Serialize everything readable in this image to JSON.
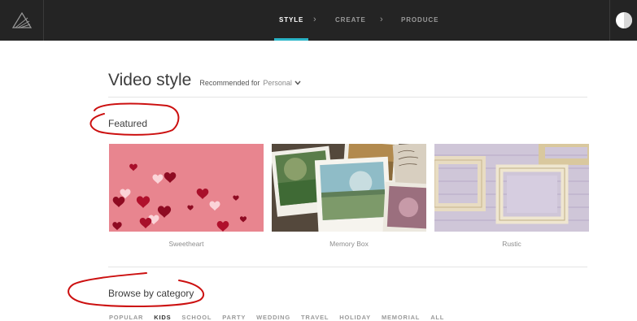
{
  "nav": {
    "steps": [
      {
        "label": "STYLE",
        "active": true
      },
      {
        "label": "CREATE",
        "active": false
      },
      {
        "label": "PRODUCE",
        "active": false
      }
    ],
    "separator": "›",
    "accent_color": "#2bb5c8",
    "logo_icon": "animoto-logo-icon",
    "user_icon": "user-avatar-icon"
  },
  "header": {
    "title": "Video style",
    "recommended_label": "Recommended for",
    "recommended_value": "Personal",
    "chevron": "⌄"
  },
  "featured": {
    "title": "Featured",
    "cards": [
      {
        "label": "Sweetheart",
        "theme": "pink-hearts"
      },
      {
        "label": "Memory Box",
        "theme": "polaroids"
      },
      {
        "label": "Rustic",
        "theme": "wood-frames"
      }
    ]
  },
  "browse": {
    "title": "Browse by category",
    "categories": [
      {
        "label": "POPULAR",
        "active": false
      },
      {
        "label": "KIDS",
        "active": true
      },
      {
        "label": "SCHOOL",
        "active": false
      },
      {
        "label": "PARTY",
        "active": false
      },
      {
        "label": "WEDDING",
        "active": false
      },
      {
        "label": "TRAVEL",
        "active": false
      },
      {
        "label": "HOLIDAY",
        "active": false
      },
      {
        "label": "MEMORIAL",
        "active": false
      },
      {
        "label": "ALL",
        "active": false
      }
    ]
  },
  "annotation_color": "#cc1010"
}
